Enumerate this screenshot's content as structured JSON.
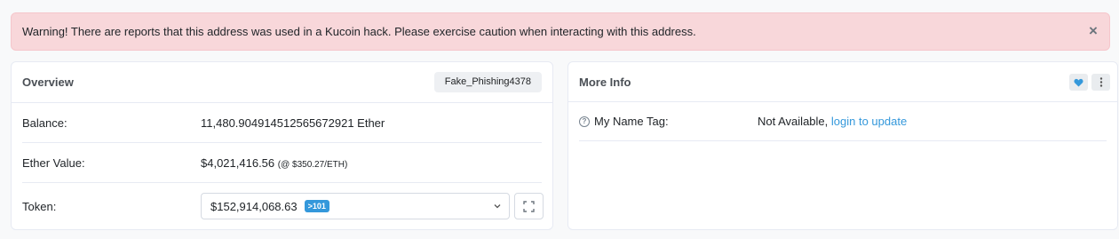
{
  "alert": {
    "message": "Warning! There are reports that this address was used in a Kucoin hack. Please exercise caution when interacting with this address.",
    "close_glyph": "×"
  },
  "overview": {
    "title": "Overview",
    "tag": "Fake_Phishing4378",
    "balance_label": "Balance:",
    "balance_value": "11,480.904914512565672921 Ether",
    "ether_value_label": "Ether Value:",
    "ether_value": "$4,021,416.56",
    "ether_price": "(@ $350.27/ETH)",
    "token_label": "Token:",
    "token_value": "$152,914,068.63",
    "token_count_badge": ">101"
  },
  "more_info": {
    "title": "More Info",
    "name_tag_label": "My Name Tag:",
    "name_tag_value": "Not Available,",
    "login_link": "login to update"
  },
  "colors": {
    "alert_bg": "#f8d7da",
    "link": "#3498db",
    "badge": "#3498db"
  }
}
